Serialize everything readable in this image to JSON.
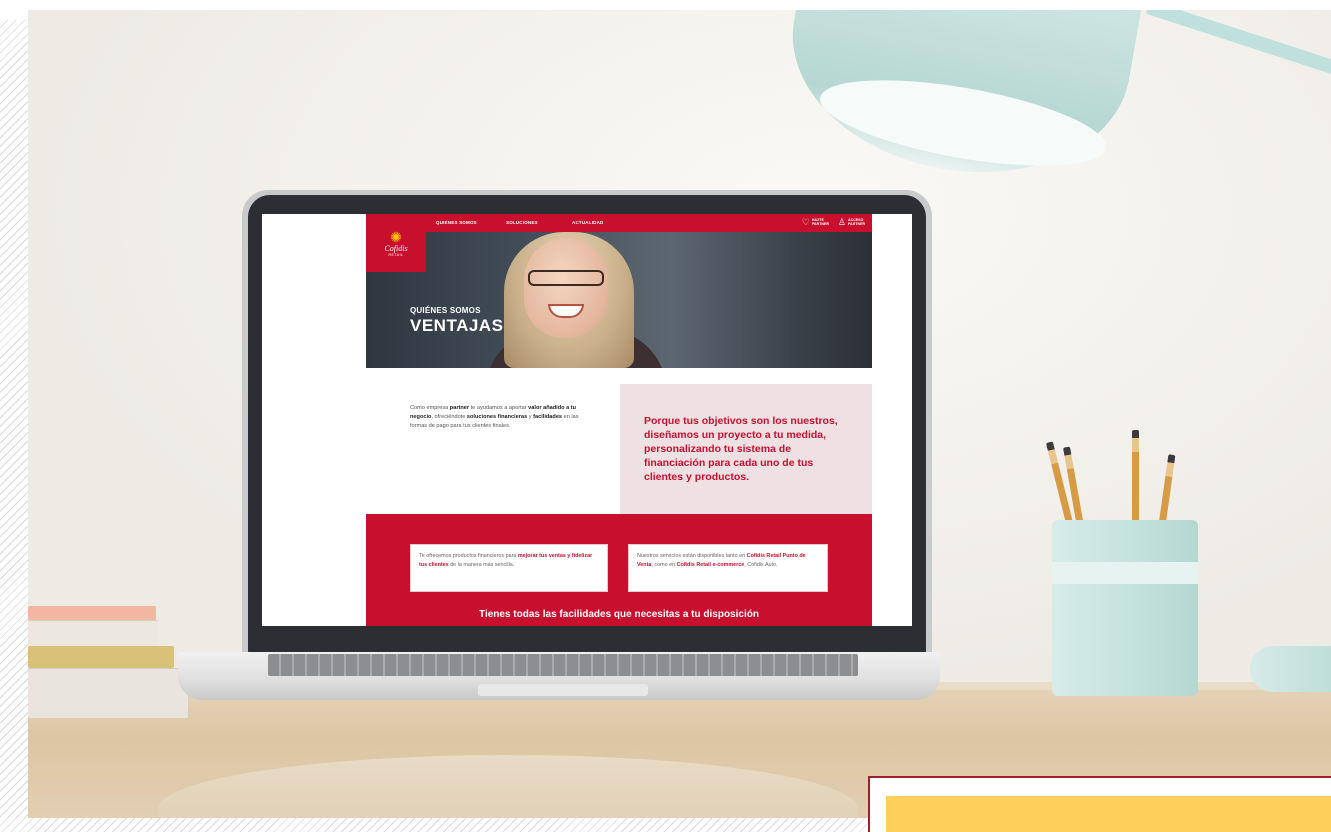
{
  "site": {
    "logo": {
      "name": "Cofidis",
      "sub": "RETAIL"
    },
    "nav": {
      "items": [
        "QUIÉNES SOMOS",
        "SOLUCIONES",
        "ACTUALIDAD"
      ],
      "right": [
        {
          "icon": "handshake-icon",
          "label": "HAZTE PARTNER"
        },
        {
          "icon": "user-icon",
          "label": "ACCESO PARTNER"
        }
      ]
    },
    "hero": {
      "pre_title": "QUIÉNES SOMOS",
      "title": "VENTAJAS"
    },
    "intro": {
      "part1": "Como empresa ",
      "bold1": "partner",
      "part2": " te ayudamos a aportar ",
      "bold2": "valor añadido a tu negocio",
      "part3": ", ofreciéndote ",
      "bold3": "soluciones financieras",
      "part4": " y ",
      "bold4": "facilidades",
      "part5": " en las formas de pago para tus clientes finales."
    },
    "highlight": "Porque tus objetivos son los nuestros, diseñamos un proyecto a tu medida, personalizando tu sistema de financiación para cada uno de tus clientes y productos.",
    "card_left": {
      "part1": "Te ofrecemos productos financieros para ",
      "bold1": "mejorar tus ventas y fidelizar tus clientes",
      "part2": " de la manera más sencilla."
    },
    "card_right": {
      "part1": "Nuestros servicios están disponibles tanto en ",
      "bold1": "Cofidis Retail Punto de Venta",
      "part2": ", como en ",
      "bold2": "Cofidis Retail e-commerce",
      "part3": ", Cofidis Auto."
    },
    "band_title": "Tienes todas las facilidades que necesitas a tu disposición"
  },
  "colors": {
    "brand_red": "#c8102e",
    "pink_panel": "#efe0e3",
    "overlay_yellow": "#fdd05c",
    "overlay_border": "#a6192e"
  }
}
